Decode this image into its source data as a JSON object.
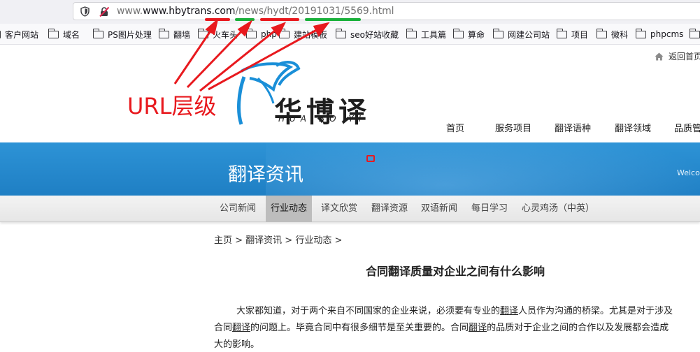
{
  "browser": {
    "url_host": "www.hbytrans.com",
    "url_path_segments": [
      "/news",
      "/hydt",
      "/20191031",
      "/5569.html"
    ]
  },
  "bookmarks": [
    {
      "label": "客户网站",
      "icon": "folder-icon"
    },
    {
      "label": "域名",
      "icon": "folder-icon"
    },
    {
      "label": "PS图片处理",
      "icon": "folder-icon"
    },
    {
      "label": "翻墙",
      "icon": "folder-icon"
    },
    {
      "label": "火车头",
      "icon": "folder-icon"
    },
    {
      "label": "php",
      "icon": "folder-icon"
    },
    {
      "label": "建站模板",
      "icon": "folder-icon"
    },
    {
      "label": "seo好站收藏",
      "icon": "folder-icon"
    },
    {
      "label": "工具篇",
      "icon": "folder-icon"
    },
    {
      "label": "算命",
      "icon": "folder-icon"
    },
    {
      "label": "网建公司站",
      "icon": "folder-icon"
    },
    {
      "label": "项目",
      "icon": "folder-icon"
    },
    {
      "label": "微科",
      "icon": "folder-icon"
    },
    {
      "label": "phpcms",
      "icon": "folder-icon"
    }
  ],
  "header": {
    "back_home": "返回首页",
    "logo_cn": "华博译",
    "logo_en": "HUA BO YI",
    "annotation": "URL层级"
  },
  "nav": [
    "首页",
    "服务项目",
    "翻译语种",
    "翻译领域",
    "品质管"
  ],
  "banner": {
    "title": "翻译资讯",
    "welcome": "Welco"
  },
  "subnav": [
    "公司新闻",
    "行业动态",
    "译文欣赏",
    "翻译资源",
    "双语新闻",
    "每日学习",
    "心灵鸡汤（中英）"
  ],
  "subnav_active": "行业动态",
  "breadcrumb": "主页 > 翻译资讯 > 行业动态 >",
  "article": {
    "title": "合同翻译质量对企业之间有什么影响",
    "line1_a": "大家都知道，对于两个来自不同国家的企业来说，必须要有专业的",
    "line1_b": "翻译",
    "line1_c": "人员作为沟通的桥梁。尤其是对于涉及",
    "line2_a": "合同",
    "line2_b": "翻译",
    "line2_c": "的问题上。毕竟合同中有很多细节是至关重要的。合同",
    "line2_d": "翻译",
    "line2_e": "的品质对于企业之间的合作以及发展都会造成",
    "line3": "大的影响。"
  },
  "colors": {
    "annotation_red": "#e8191e",
    "underline_green": "#19b03a",
    "banner_blue": "#2d93d6",
    "logo_blue": "#1a8fd8"
  }
}
